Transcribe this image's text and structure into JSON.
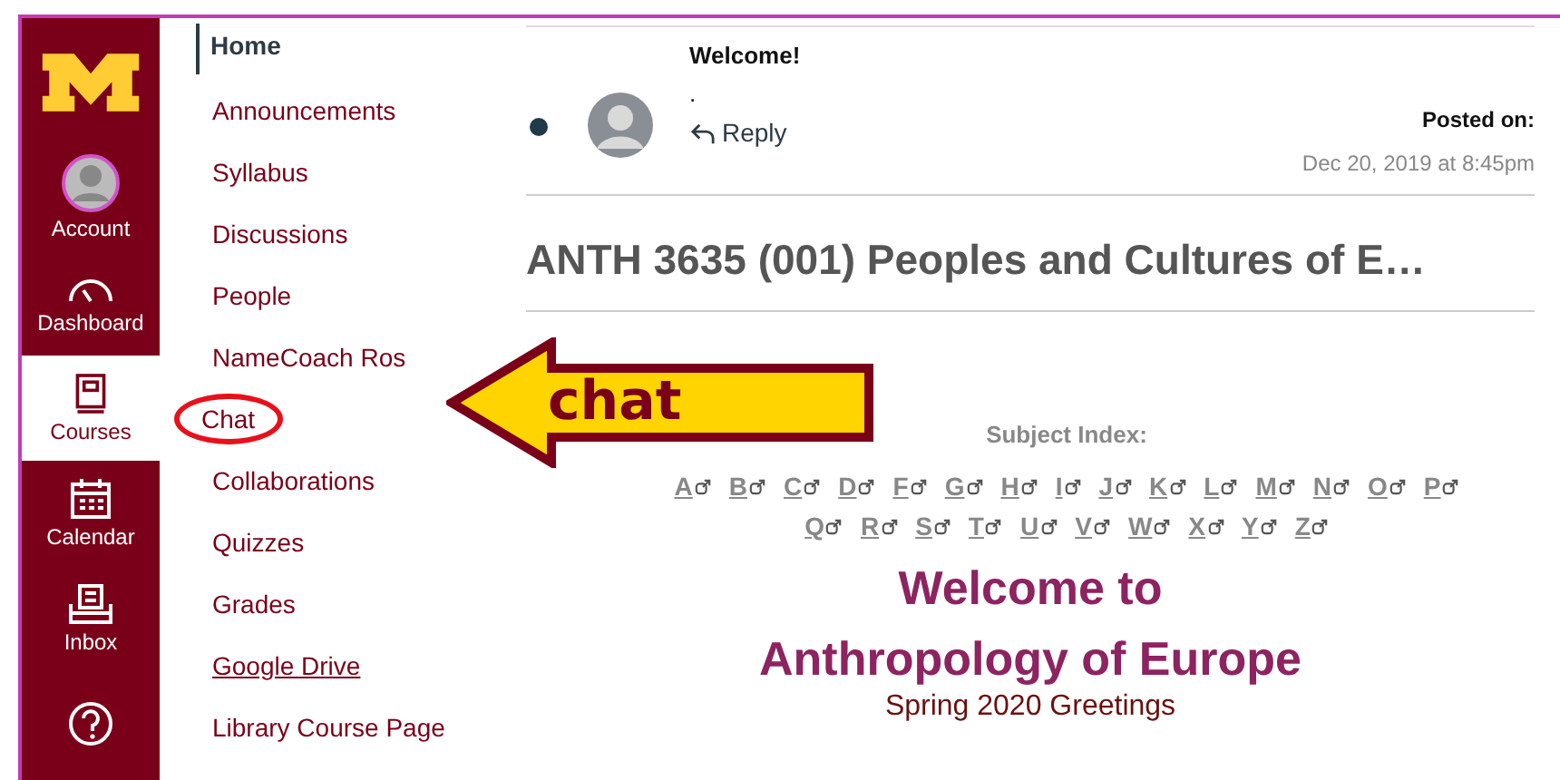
{
  "global_nav": [
    {
      "kind": "account",
      "label": "Account",
      "selected": false
    },
    {
      "kind": "dashboard",
      "label": "Dashboard",
      "selected": false
    },
    {
      "kind": "courses",
      "label": "Courses",
      "selected": true
    },
    {
      "kind": "calendar",
      "label": "Calendar",
      "selected": false
    },
    {
      "kind": "inbox",
      "label": "Inbox",
      "selected": false
    },
    {
      "kind": "help",
      "selected": false
    }
  ],
  "course_nav": [
    {
      "label": "Home",
      "selected": true,
      "underlined": false
    },
    {
      "label": "Announcements",
      "selected": false,
      "underlined": false
    },
    {
      "label": "Syllabus",
      "selected": false,
      "underlined": false
    },
    {
      "label": "Discussions",
      "selected": false,
      "underlined": false
    },
    {
      "label": "People",
      "selected": false,
      "underlined": false
    },
    {
      "label": "NameCoach Ros",
      "selected": false,
      "underlined": false
    },
    {
      "label": "Chat",
      "selected": false,
      "underlined": false,
      "circled": true
    },
    {
      "label": "Collaborations",
      "selected": false,
      "underlined": false
    },
    {
      "label": "Quizzes",
      "selected": false,
      "underlined": false
    },
    {
      "label": "Grades",
      "selected": false,
      "underlined": false
    },
    {
      "label": "Google Drive",
      "selected": false,
      "underlined": true
    },
    {
      "label": "Library Course Page",
      "selected": false,
      "underlined": false
    }
  ],
  "announcement": {
    "unread": true,
    "title": "Welcome!",
    "body": ".",
    "reply": "Reply",
    "posted_label": "Posted on:",
    "posted_date": "Dec 20, 2019 at 8:45pm"
  },
  "course_title": "ANTH 3635 (001) Peoples and Cultures of E…",
  "subject_index": {
    "label": "Subject Index:",
    "rows": [
      [
        "A",
        "B",
        "C",
        "D",
        "F",
        "G",
        "H",
        "I",
        "J",
        "K",
        "L",
        "M",
        "N",
        "O",
        "P"
      ],
      [
        "Q",
        "R",
        "S",
        "T",
        "U",
        "V",
        "W",
        "X",
        "Y",
        "Z"
      ]
    ]
  },
  "welcome": [
    "Welcome to",
    "Anthropology of Europe"
  ],
  "greeting": "Spring 2020 Greetings",
  "annotation": {
    "label": "chat"
  }
}
